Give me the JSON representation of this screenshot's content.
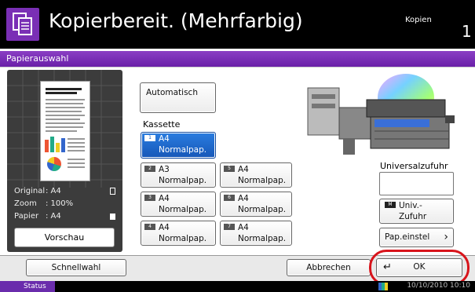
{
  "header": {
    "title": "Kopierbereit. (Mehrfarbig)",
    "copies_label": "Kopien",
    "copies_count": "1",
    "icon": "copy-icon"
  },
  "screen_title": "Papierauswahl",
  "preview": {
    "info": [
      {
        "key": "Original",
        "value": ": A4",
        "icon": "portrait-page-icon"
      },
      {
        "key": "Zoom",
        "value": ": 100%"
      },
      {
        "key": "Papier",
        "value": ": A4",
        "icon": "paper-icon"
      }
    ],
    "button": "Vorschau"
  },
  "auto_button": "Automatisch",
  "cassette_label": "Kassette",
  "cassettes": [
    {
      "tray": "1",
      "line1": "A4",
      "line2": "Normalpap.",
      "selected": true
    },
    {
      "tray": "2",
      "line1": "A3",
      "line2": "Normalpap."
    },
    {
      "tray": "5",
      "line1": "A4",
      "line2": "Normalpap."
    },
    {
      "tray": "3",
      "line1": "A4",
      "line2": "Normalpap."
    },
    {
      "tray": "6",
      "line1": "A4",
      "line2": "Normalpap."
    },
    {
      "tray": "4",
      "line1": "A4",
      "line2": "Normalpap."
    },
    {
      "tray": "7",
      "line1": "A4",
      "line2": "Normalpap."
    }
  ],
  "bypass": {
    "label": "Universalzufuhr",
    "tray": "M",
    "line1": "Univ.-",
    "line2": "Zufuhr",
    "settings_button": "Pap.einstel"
  },
  "bottom": {
    "quick": "Schnellwahl",
    "cancel": "Abbrechen",
    "ok": "OK"
  },
  "status": {
    "label": "Status",
    "datetime": "10/10/2010  10:10"
  },
  "colors": {
    "accent_purple": "#7a2fb5",
    "selected_blue": "#1657b8",
    "highlight_red": "#d8141b"
  }
}
